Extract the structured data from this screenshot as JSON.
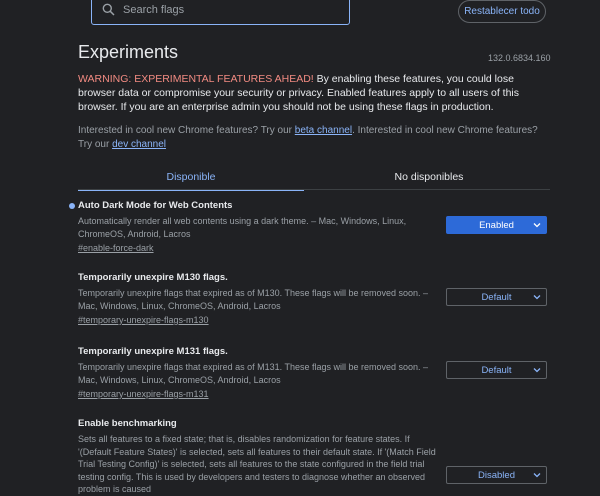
{
  "search": {
    "placeholder": "Search flags"
  },
  "header": {
    "reset_label": "Restablecer todo",
    "title": "Experiments",
    "version": "132.0.6834.160"
  },
  "warning": {
    "prefix": "WARNING: EXPERIMENTAL FEATURES AHEAD!",
    "text": " By enabling these features, you could lose browser data or compromise your security or privacy. Enabled features apply to all users of this browser. If you are an enterprise admin you should not be using these flags in production."
  },
  "interest": {
    "part1": "Interested in cool new Chrome features? Try our ",
    "beta_link": "beta channel",
    "part2": ". Interested in cool new Chrome features? Try our ",
    "dev_link": "dev channel"
  },
  "tabs": [
    {
      "label": "Disponible"
    },
    {
      "label": "No disponibles"
    }
  ],
  "experiments": [
    {
      "title": "Auto Dark Mode for Web Contents",
      "description": "Automatically render all web contents using a dark theme. – Mac, Windows, Linux, ChromeOS, Android, Lacros",
      "link": "#enable-force-dark",
      "value": "Enabled",
      "modified": true
    },
    {
      "title": "Temporarily unexpire M130 flags.",
      "description": "Temporarily unexpire flags that expired as of M130. These flags will be removed soon. – Mac, Windows, Linux, ChromeOS, Android, Lacros",
      "link": "#temporary-unexpire-flags-m130",
      "value": "Default",
      "modified": false
    },
    {
      "title": "Temporarily unexpire M131 flags.",
      "description": "Temporarily unexpire flags that expired as of M131. These flags will be removed soon. – Mac, Windows, Linux, ChromeOS, Android, Lacros",
      "link": "#temporary-unexpire-flags-m131",
      "value": "Default",
      "modified": false
    },
    {
      "title": "Enable benchmarking",
      "description": "Sets all features to a fixed state; that is, disables randomization for feature states. If '(Default Feature States)' is selected, sets all features to their default state. If '(Match Field Trial Testing Config)' is selected, sets all features to the state configured in the field trial testing config. This is used by developers and testers to diagnose whether an observed problem is caused",
      "link": "",
      "value": "Disabled",
      "modified": false
    }
  ],
  "colors": {
    "background": "#202124",
    "accent": "#8ab4f8",
    "warning": "#f28b82",
    "enabled_select": "#2d6ad8"
  },
  "icons": {
    "search": "search-icon",
    "dropdown": "chevron-down-icon",
    "modified": "modified-dot-icon"
  }
}
